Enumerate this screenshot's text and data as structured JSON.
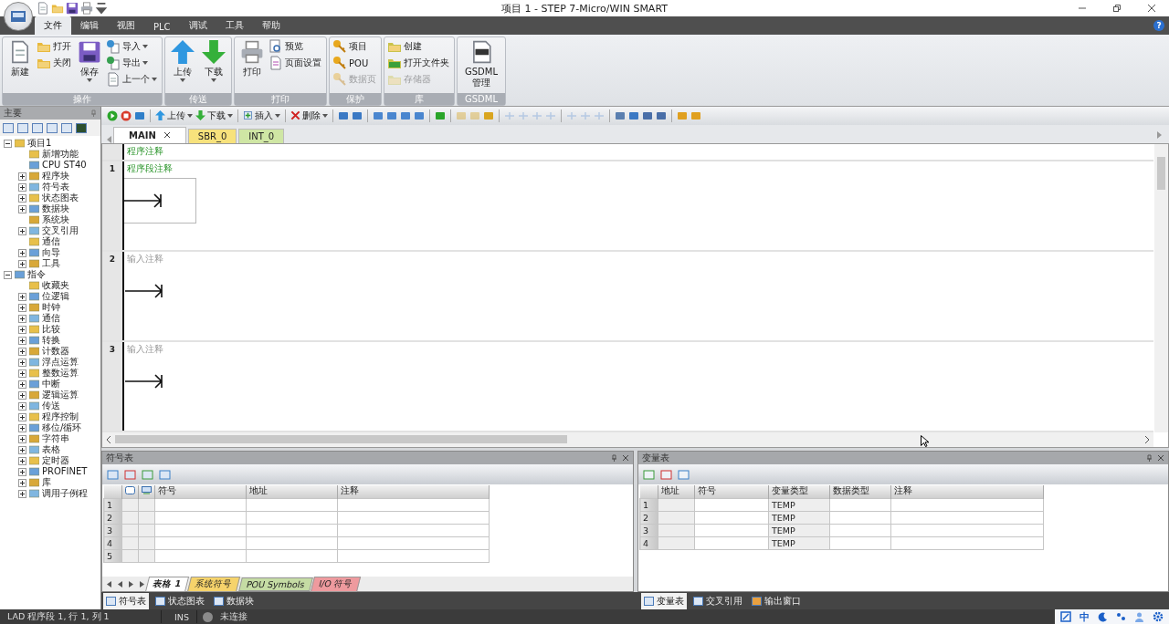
{
  "window": {
    "title": "项目 1 - STEP 7-Micro/WIN SMART",
    "help": "?"
  },
  "menu_tabs": [
    {
      "label": "文件",
      "selected": true
    },
    {
      "label": "编辑",
      "selected": false
    },
    {
      "label": "视图",
      "selected": false
    },
    {
      "label": "PLC",
      "selected": false
    },
    {
      "label": "调试",
      "selected": false
    },
    {
      "label": "工具",
      "selected": false
    },
    {
      "label": "帮助",
      "selected": false
    }
  ],
  "ribbon_groups": [
    {
      "label": "操作",
      "columns": [
        {
          "kind": "large",
          "items": [
            {
              "label": "新建",
              "dropdown": false,
              "disabled": false
            }
          ]
        },
        {
          "kind": "small",
          "items": [
            {
              "label": "打开",
              "dropdown": false,
              "disabled": false
            },
            {
              "label": "关闭",
              "dropdown": false,
              "disabled": false
            }
          ]
        },
        {
          "kind": "large",
          "items": [
            {
              "label": "保存",
              "dropdown": true,
              "disabled": false
            }
          ]
        },
        {
          "kind": "small",
          "items": [
            {
              "label": "导入",
              "dropdown": true,
              "disabled": false
            },
            {
              "label": "导出",
              "dropdown": true,
              "disabled": false
            },
            {
              "label": "上一个",
              "dropdown": true,
              "disabled": false
            }
          ]
        }
      ]
    },
    {
      "label": "传送",
      "columns": [
        {
          "kind": "large",
          "items": [
            {
              "label": "上传",
              "dropdown": true,
              "disabled": false
            }
          ]
        },
        {
          "kind": "large",
          "items": [
            {
              "label": "下载",
              "dropdown": true,
              "disabled": false
            }
          ]
        }
      ]
    },
    {
      "label": "打印",
      "columns": [
        {
          "kind": "large",
          "items": [
            {
              "label": "打印",
              "dropdown": false,
              "disabled": false
            }
          ]
        },
        {
          "kind": "small",
          "items": [
            {
              "label": "预览",
              "dropdown": false,
              "disabled": false
            },
            {
              "label": "页面设置",
              "dropdown": false,
              "disabled": false
            }
          ]
        }
      ]
    },
    {
      "label": "保护",
      "columns": [
        {
          "kind": "small",
          "items": [
            {
              "label": "项目",
              "dropdown": false,
              "disabled": false
            },
            {
              "label": "POU",
              "dropdown": false,
              "disabled": false
            },
            {
              "label": "数据页",
              "dropdown": false,
              "disabled": true
            }
          ]
        }
      ]
    },
    {
      "label": "库",
      "columns": [
        {
          "kind": "small",
          "items": [
            {
              "label": "创建",
              "dropdown": false,
              "disabled": false
            },
            {
              "label": "打开文件夹",
              "dropdown": false,
              "disabled": false
            },
            {
              "label": "存储器",
              "dropdown": false,
              "disabled": true
            }
          ]
        }
      ]
    },
    {
      "label": "GSDML",
      "columns": [
        {
          "kind": "large",
          "items": [
            {
              "label": "GSDML 管理",
              "dropdown": false,
              "disabled": false
            }
          ]
        }
      ]
    }
  ],
  "left_pane": {
    "title": "主要",
    "tree": [
      {
        "label": "项目1",
        "expanded": true,
        "children": [
          {
            "label": "新增功能"
          },
          {
            "label": "CPU ST40"
          },
          {
            "label": "程序块",
            "expanded": false
          },
          {
            "label": "符号表",
            "expanded": false
          },
          {
            "label": "状态图表",
            "expanded": false
          },
          {
            "label": "数据块",
            "expanded": false
          },
          {
            "label": "系统块"
          },
          {
            "label": "交叉引用",
            "expanded": false
          },
          {
            "label": "通信"
          },
          {
            "label": "向导",
            "expanded": false
          },
          {
            "label": "工具",
            "expanded": false
          }
        ]
      },
      {
        "label": "指令",
        "expanded": true,
        "children": [
          {
            "label": "收藏夹"
          },
          {
            "label": "位逻辑",
            "expanded": false
          },
          {
            "label": "时钟",
            "expanded": false
          },
          {
            "label": "通信",
            "expanded": false
          },
          {
            "label": "比较",
            "expanded": false
          },
          {
            "label": "转换",
            "expanded": false
          },
          {
            "label": "计数器",
            "expanded": false
          },
          {
            "label": "浮点运算",
            "expanded": false
          },
          {
            "label": "整数运算",
            "expanded": false
          },
          {
            "label": "中断",
            "expanded": false
          },
          {
            "label": "逻辑运算",
            "expanded": false
          },
          {
            "label": "传送",
            "expanded": false
          },
          {
            "label": "程序控制",
            "expanded": false
          },
          {
            "label": "移位/循环",
            "expanded": false
          },
          {
            "label": "字符串",
            "expanded": false
          },
          {
            "label": "表格",
            "expanded": false
          },
          {
            "label": "定时器",
            "expanded": false
          },
          {
            "label": "PROFINET",
            "expanded": false
          },
          {
            "label": "库",
            "expanded": false
          },
          {
            "label": "调用子例程",
            "expanded": false
          }
        ]
      }
    ]
  },
  "toolbar": [
    {
      "kind": "icon",
      "disabled": false
    },
    {
      "kind": "icon",
      "disabled": false
    },
    {
      "kind": "icon",
      "disabled": false
    },
    {
      "kind": "separator"
    },
    {
      "kind": "button",
      "label": "上传",
      "disabled": false
    },
    {
      "kind": "button",
      "label": "下载",
      "disabled": false
    },
    {
      "kind": "separator"
    },
    {
      "kind": "button",
      "label": "插入",
      "disabled": false
    },
    {
      "kind": "separator"
    },
    {
      "kind": "button",
      "label": "删除",
      "disabled": false
    },
    {
      "kind": "separator"
    },
    {
      "kind": "icon",
      "disabled": false
    },
    {
      "kind": "icon",
      "disabled": false
    },
    {
      "kind": "separator"
    },
    {
      "kind": "icon",
      "disabled": false
    },
    {
      "kind": "icon",
      "disabled": false
    },
    {
      "kind": "icon",
      "disabled": false
    },
    {
      "kind": "icon",
      "disabled": false
    },
    {
      "kind": "separator"
    },
    {
      "kind": "icon",
      "disabled": false
    },
    {
      "kind": "separator"
    },
    {
      "kind": "icon",
      "disabled": true
    },
    {
      "kind": "icon",
      "disabled": true
    },
    {
      "kind": "icon",
      "disabled": false
    },
    {
      "kind": "separator"
    },
    {
      "kind": "icon",
      "disabled": true
    },
    {
      "kind": "icon",
      "disabled": true
    },
    {
      "kind": "icon",
      "disabled": true
    },
    {
      "kind": "icon",
      "disabled": true
    },
    {
      "kind": "separator"
    },
    {
      "kind": "icon",
      "disabled": true
    },
    {
      "kind": "icon",
      "disabled": true
    },
    {
      "kind": "icon",
      "disabled": true
    },
    {
      "kind": "separator"
    },
    {
      "kind": "icon",
      "disabled": false
    },
    {
      "kind": "icon",
      "disabled": false
    },
    {
      "kind": "icon",
      "disabled": false
    },
    {
      "kind": "icon",
      "disabled": false
    },
    {
      "kind": "separator"
    },
    {
      "kind": "icon",
      "disabled": false
    },
    {
      "kind": "icon",
      "disabled": false
    }
  ],
  "editor_tabs": [
    {
      "label": "MAIN",
      "selected": true,
      "closable": true,
      "color": "#ffffff"
    },
    {
      "label": "SBR_0",
      "selected": false,
      "closable": false,
      "color": "#f7e27c"
    },
    {
      "label": "INT_0",
      "selected": false,
      "closable": false,
      "color": "#cfe6a4"
    }
  ],
  "program_comment": "程序注释",
  "networks": [
    {
      "number": "1",
      "comment": "程序段注释",
      "kind": "set",
      "selected": true
    },
    {
      "number": "2",
      "comment": "输入注释",
      "kind": "placeholder",
      "selected": false
    },
    {
      "number": "3",
      "comment": "输入注释",
      "kind": "placeholder",
      "selected": false
    }
  ],
  "symbol_table": {
    "title": "符号表",
    "columns": [
      "符号",
      "地址",
      "注释"
    ],
    "rows": [
      {
        "number": "1"
      },
      {
        "number": "2"
      },
      {
        "number": "3"
      },
      {
        "number": "4"
      },
      {
        "number": "5"
      }
    ],
    "sheets": [
      {
        "label": "表格 1",
        "selected": true,
        "color": "#ffffff"
      },
      {
        "label": "系统符号",
        "selected": false,
        "color": "#f6d36b"
      },
      {
        "label": "POU Symbols",
        "selected": false,
        "color": "#c5dca4"
      },
      {
        "label": "I/O 符号",
        "selected": false,
        "color": "#ee9a9e"
      }
    ]
  },
  "left_panel_tabs": [
    {
      "label": "符号表",
      "selected": true
    },
    {
      "label": "状态图表",
      "selected": false
    },
    {
      "label": "数据块",
      "selected": false
    }
  ],
  "variable_table": {
    "title": "变量表",
    "columns": [
      "地址",
      "符号",
      "变量类型",
      "数据类型",
      "注释"
    ],
    "rows": [
      {
        "number": "1",
        "var_type": "TEMP"
      },
      {
        "number": "2",
        "var_type": "TEMP"
      },
      {
        "number": "3",
        "var_type": "TEMP"
      },
      {
        "number": "4",
        "var_type": "TEMP"
      }
    ]
  },
  "right_panel_tabs": [
    {
      "label": "变量表",
      "selected": true
    },
    {
      "label": "交叉引用",
      "selected": false
    },
    {
      "label": "输出窗口",
      "selected": false
    }
  ],
  "status_bar": {
    "position": "LAD 程序段 1, 行 1, 列 1",
    "mode": "INS",
    "connection": "未连接",
    "connected": false,
    "ime": "中"
  }
}
